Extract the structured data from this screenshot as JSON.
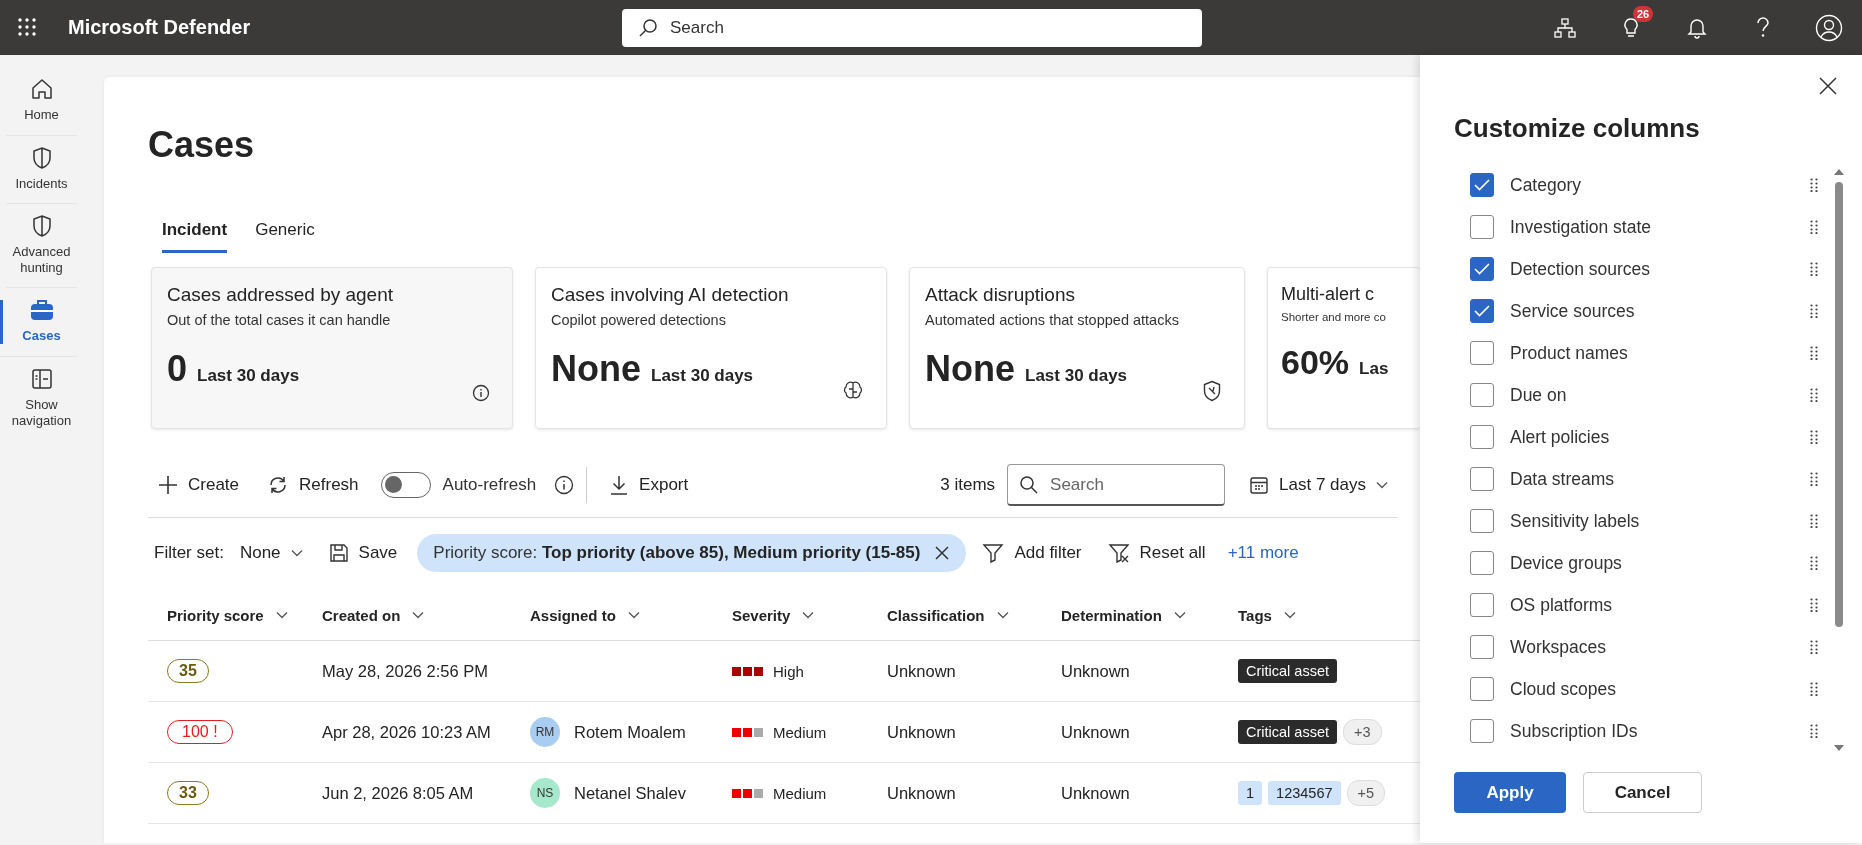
{
  "topbar": {
    "title": "Microsoft Defender",
    "search": {
      "placeholder": "Search"
    },
    "notification_count": "26"
  },
  "nav": {
    "items": [
      {
        "label": "Home",
        "kind": "home",
        "selected": false
      },
      {
        "label": "Incidents",
        "kind": "shield",
        "selected": false
      },
      {
        "label": "Advanced hunting",
        "kind": "shield",
        "selected": false
      },
      {
        "label": "Cases",
        "kind": "briefcase",
        "selected": true
      },
      {
        "label": "Show navigation",
        "kind": "panel",
        "selected": false
      }
    ]
  },
  "page": {
    "title": "Cases",
    "tabs": [
      {
        "label": "Incident",
        "selected": true
      },
      {
        "label": "Generic",
        "selected": false
      }
    ]
  },
  "cards": [
    {
      "title": "Cases addressed by agent",
      "subtitle": "Out of the total cases it can handle",
      "value": "0",
      "period": "Last 30 days",
      "kind": "info"
    },
    {
      "title": "Cases involving AI detection",
      "subtitle": "Copilot powered detections",
      "value": "None",
      "period": "Last 30 days",
      "kind": "brain"
    },
    {
      "title": "Attack disruptions",
      "subtitle": "Automated actions that stopped attacks",
      "value": "None",
      "period": "Last 30 days",
      "kind": "shield"
    },
    {
      "title": "Multi-alert c",
      "subtitle": "Shorter and more co",
      "value": "60%",
      "period": "Las",
      "kind": "cut"
    }
  ],
  "toolbar": {
    "create": "Create",
    "refresh": "Refresh",
    "auto_refresh": {
      "label": "Auto-refresh",
      "on": false
    },
    "export": "Export",
    "count": "3 items",
    "search": {
      "placeholder": "Search"
    },
    "date_range": "Last 7 days"
  },
  "filters": {
    "label": "Filter set:",
    "set": "None",
    "save": "Save",
    "chip": {
      "name": "Priority score:",
      "value": "Top priority (above 85), Medium priority (15-85)"
    },
    "add": "Add filter",
    "reset": "Reset all",
    "more": "+11 more"
  },
  "table": {
    "columns": [
      "Priority score",
      "Created on",
      "Assigned to",
      "Severity",
      "Classification",
      "Determination",
      "Tags"
    ],
    "rows": [
      {
        "priority": {
          "text": "35",
          "kind": "normal"
        },
        "created": "May 28, 2026 2:56 PM",
        "severity": {
          "label": "High",
          "kind": "high"
        },
        "classification": "Unknown",
        "determination": "Unknown",
        "tags": [
          {
            "text": "Critical asset",
            "kind": "asset"
          }
        ]
      },
      {
        "priority": {
          "text": "100 !",
          "kind": "critical"
        },
        "created": "Apr 28, 2026 10:23 AM",
        "assigned": {
          "initials": "RM",
          "name": "Rotem Moalem",
          "color": "#a9cdf0"
        },
        "severity": {
          "label": "Medium",
          "kind": "medium"
        },
        "classification": "Unknown",
        "determination": "Unknown",
        "tags": [
          {
            "text": "Critical asset",
            "kind": "asset"
          },
          {
            "text": "+3",
            "kind": "more"
          }
        ]
      },
      {
        "priority": {
          "text": "33",
          "kind": "normal"
        },
        "created": "Jun 2, 2026 8:05 AM",
        "assigned": {
          "initials": "NS",
          "name": "Netanel Shalev",
          "color": "#a6e8cc"
        },
        "severity": {
          "label": "Medium",
          "kind": "medium"
        },
        "classification": "Unknown",
        "determination": "Unknown",
        "tags": [
          {
            "text": "1",
            "kind": "label"
          },
          {
            "text": "1234567",
            "kind": "label"
          },
          {
            "text": "+5",
            "kind": "more"
          }
        ]
      }
    ]
  },
  "panel": {
    "title": "Customize columns",
    "columns": [
      {
        "label": "Category",
        "checked": true
      },
      {
        "label": "Investigation state",
        "checked": false
      },
      {
        "label": "Detection sources",
        "checked": true
      },
      {
        "label": "Service sources",
        "checked": true
      },
      {
        "label": "Product names",
        "checked": false
      },
      {
        "label": "Due on",
        "checked": false
      },
      {
        "label": "Alert policies",
        "checked": false
      },
      {
        "label": "Data streams",
        "checked": false
      },
      {
        "label": "Sensitivity labels",
        "checked": false
      },
      {
        "label": "Device groups",
        "checked": false
      },
      {
        "label": "OS platforms",
        "checked": false
      },
      {
        "label": "Workspaces",
        "checked": false
      },
      {
        "label": "Cloud scopes",
        "checked": false
      },
      {
        "label": "Subscription IDs",
        "checked": false
      }
    ],
    "apply": "Apply",
    "cancel": "Cancel"
  }
}
